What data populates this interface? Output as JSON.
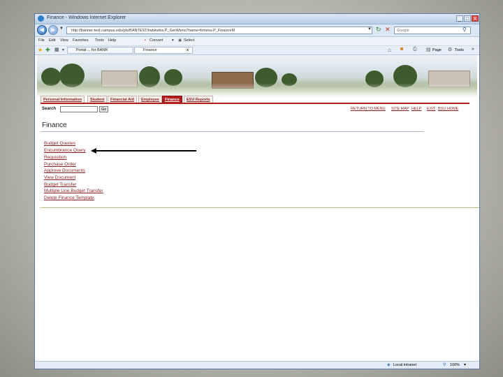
{
  "browser": {
    "title": "Finance - Windows Internet Explorer",
    "window_controls": [
      "_",
      "□",
      "X"
    ],
    "address": "http://banner-test.campus.edu/pls/BANTEST/twbkwbis.P_GenMenu?name=bmenu.P_FinanceM",
    "search_placeholder": "Google",
    "menus": [
      "File",
      "Edit",
      "View",
      "Favorites",
      "Tools",
      "Help"
    ],
    "convert_label": "Convert",
    "select_label": "Select",
    "tabs": [
      "Portal ... for BANR",
      "Finance"
    ],
    "tab_close": "x",
    "page_label": "Page",
    "tools_label": "Tools",
    "status_zone": "Local intranet",
    "zoom": "100%"
  },
  "site": {
    "nav_tabs": [
      "Personal Information",
      "Student",
      "Financial Aid",
      "Employee",
      "Finance",
      "ESU Reports"
    ],
    "active_tab": "Finance",
    "search_label": "Search",
    "go_label": "Go",
    "top_links": [
      "RETURN TO MENU",
      "SITE MAP",
      "HELP",
      "EXIT",
      "BSU HOME"
    ],
    "page_title": "Finance",
    "menu_items": [
      "Budget Queries",
      "Encumbrance Query",
      "Requisition",
      "Purchase Order",
      "Approve Documents",
      "View Document",
      "Budget Transfer",
      "Multiple Line Budget Transfer",
      "Delete Finance Template"
    ]
  },
  "colors": {
    "accent": "#b11c1c",
    "link": "#8a1f1f",
    "rule": "#b7c36e"
  }
}
